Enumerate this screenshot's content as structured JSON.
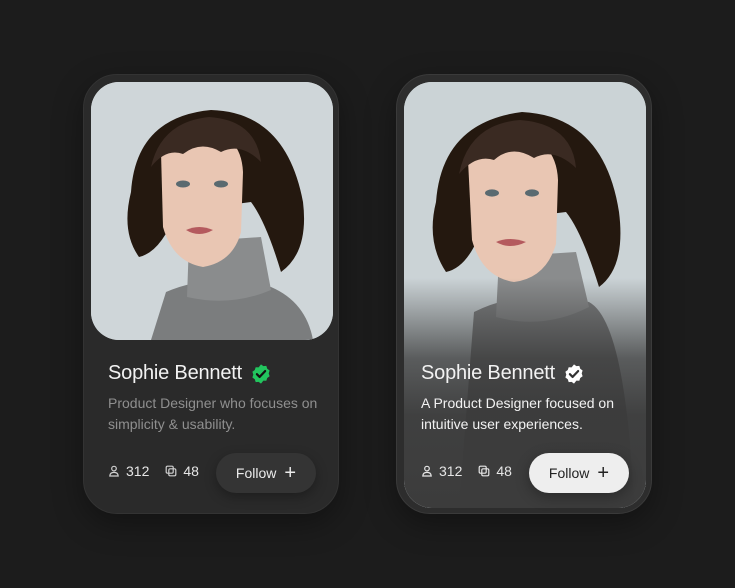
{
  "cards": [
    {
      "name": "Sophie Bennett",
      "bio": "Product Designer who focuses on simplicity & usability.",
      "followers": "312",
      "projects": "48",
      "follow_label": "Follow",
      "verified_color": "#22c55e"
    },
    {
      "name": "Sophie Bennett",
      "bio": "A Product Designer focused on intuitive user experiences.",
      "followers": "312",
      "projects": "48",
      "follow_label": "Follow",
      "verified_color": "#ffffff"
    }
  ],
  "icons": {
    "verified": "verified-badge-icon",
    "followers": "user-icon",
    "projects": "copy-icon",
    "follow": "plus-icon"
  }
}
